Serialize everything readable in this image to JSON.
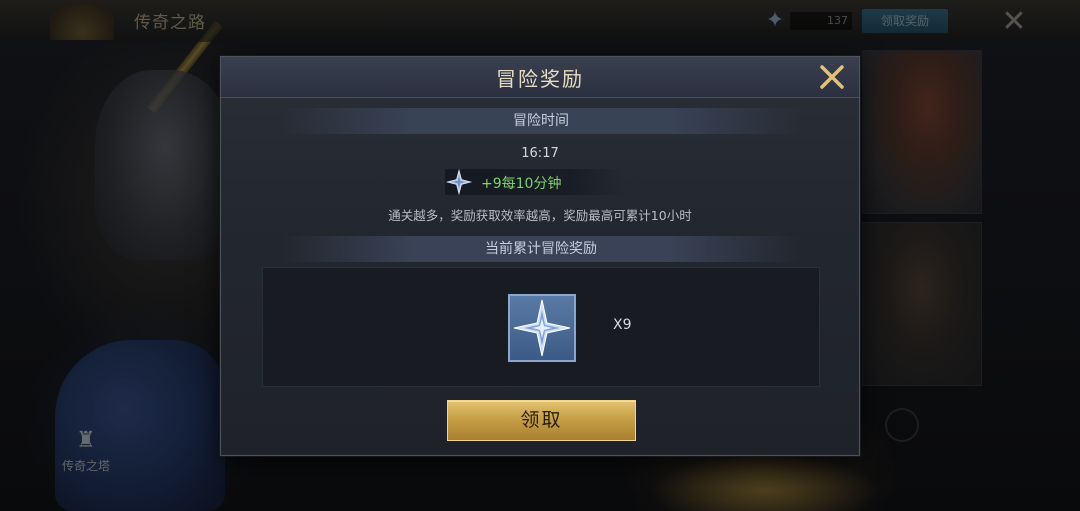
{
  "background": {
    "topbar_title": "传奇之路",
    "gem_count": "137",
    "top_button_label": "领取奖励",
    "tower_label": "传奇之塔",
    "close_icon": "close-icon"
  },
  "modal": {
    "title": "冒险奖励",
    "section_time_label": "冒险时间",
    "time_value": "16:17",
    "rate_text": "+9每10分钟",
    "hint": "通关越多，奖励获取效率越高，奖励最高可累计10小时",
    "section_total_label": "当前累计冒险奖励",
    "reward": {
      "icon": "star-crystal-icon",
      "count": "X9"
    },
    "claim_label": "领取"
  },
  "colors": {
    "accent_gold": "#c79f48",
    "rate_green": "#7fd26a",
    "title": "#e6dcc2"
  }
}
